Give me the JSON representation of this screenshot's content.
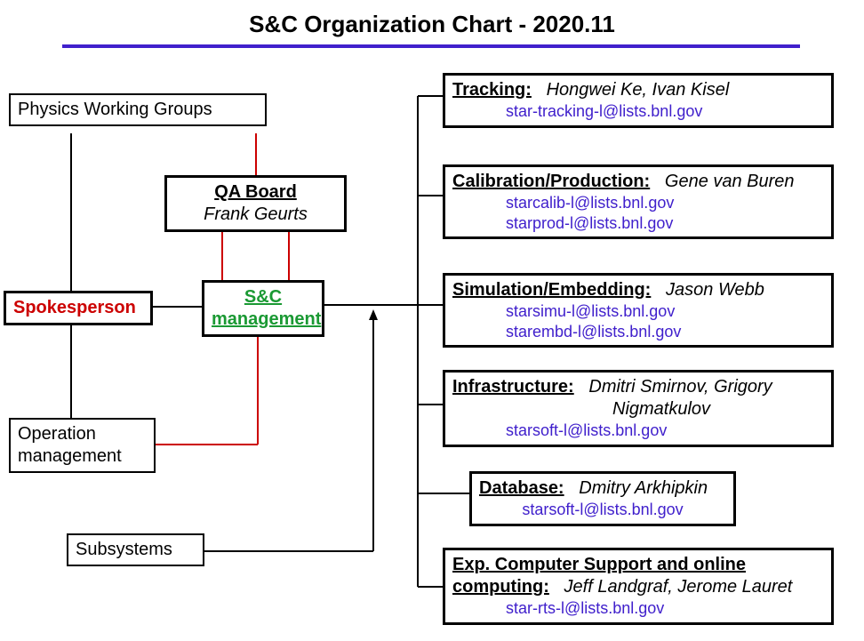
{
  "title": "S&C Organization Chart - 2020.11",
  "nodes": {
    "pwg": "Physics Working Groups",
    "qa_board": {
      "title": "QA Board",
      "person": "Frank Geurts"
    },
    "spokesperson": "Spokesperson",
    "sc_mgmt": {
      "title": "S&C",
      "title2": "management"
    },
    "op_mgmt": {
      "line1": "Operation",
      "line2": "management"
    },
    "subsystems": "Subsystems"
  },
  "areas": {
    "tracking": {
      "title": "Tracking:",
      "people": "Hongwei Ke, Ivan Kisel",
      "emails": [
        "star-tracking-l@lists.bnl.gov"
      ]
    },
    "calib": {
      "title": "Calibration/Production:",
      "people": "Gene van Buren",
      "emails": [
        "starcalib-l@lists.bnl.gov",
        "starprod-l@lists.bnl.gov"
      ]
    },
    "sim": {
      "title": "Simulation/Embedding:",
      "people": "Jason Webb",
      "emails": [
        "starsimu-l@lists.bnl.gov",
        "starembd-l@lists.bnl.gov"
      ]
    },
    "infra": {
      "title": "Infrastructure:",
      "people": "Dmitri Smirnov, Grigory",
      "people2": "Nigmatkulov",
      "emails": [
        "starsoft-l@lists.bnl.gov"
      ]
    },
    "db": {
      "title": "Database:",
      "people": "Dmitry Arkhipkin",
      "emails": [
        "starsoft-l@lists.bnl.gov"
      ]
    },
    "ecs": {
      "title": "Exp. Computer Support and online",
      "title2": "computing:",
      "people": "Jeff Landgraf, Jerome Lauret",
      "emails": [
        "star-rts-l@lists.bnl.gov"
      ]
    }
  }
}
